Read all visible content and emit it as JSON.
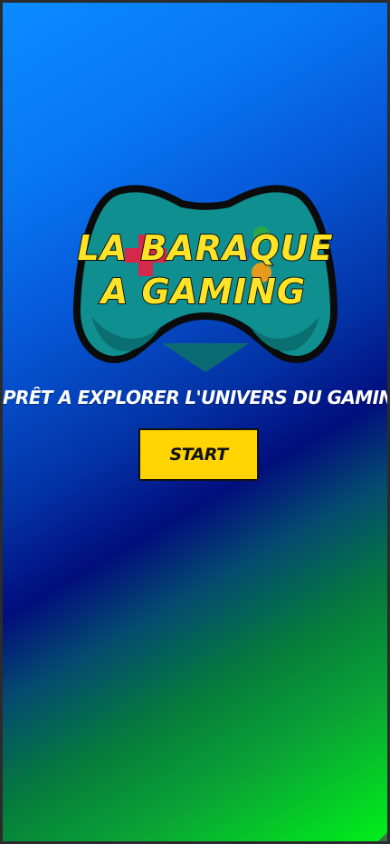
{
  "logo": {
    "line1": "LA BARAQUE",
    "line2": "A GAMING",
    "icon": "gamepad-icon"
  },
  "tagline": "PRÊT A EXPLORER L'UNIVERS DU GAMING ?",
  "start_button": {
    "label": "START"
  },
  "colors": {
    "gradient_top": "#0a8cff",
    "gradient_mid": "#020e7e",
    "gradient_bottom": "#00f01a",
    "gamepad_body": "#0f8f8f",
    "logo_text": "#ffe326",
    "button_bg": "#ffd400"
  }
}
